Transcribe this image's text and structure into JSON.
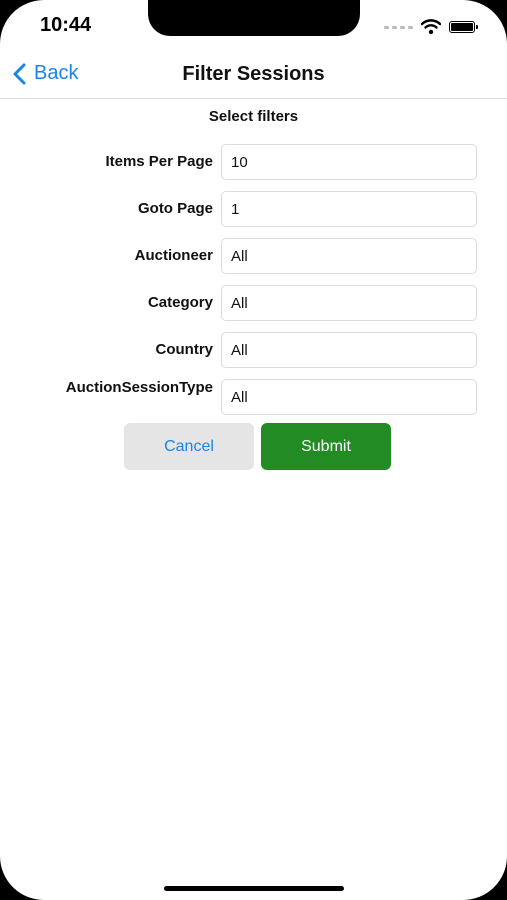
{
  "status_bar": {
    "time": "10:44"
  },
  "nav": {
    "back_label": "Back",
    "title": "Filter Sessions"
  },
  "form": {
    "section_title": "Select filters",
    "fields": [
      {
        "label": "Items Per Page",
        "value": "10"
      },
      {
        "label": "Goto Page",
        "value": "1"
      },
      {
        "label": "Auctioneer",
        "value": "All"
      },
      {
        "label": "Category",
        "value": "All"
      },
      {
        "label": "Country",
        "value": "All"
      },
      {
        "label": "AuctionSessionType",
        "value": "All"
      }
    ]
  },
  "actions": {
    "cancel_label": "Cancel",
    "submit_label": "Submit"
  },
  "colors": {
    "accent": "#1a84e7",
    "submit_bg": "#238b23",
    "cancel_bg": "#e5e5e5"
  },
  "icons": {
    "back": "chevron-left-icon",
    "wifi": "wifi-icon",
    "battery": "battery-icon",
    "signal": "cellular-signal-icon"
  }
}
